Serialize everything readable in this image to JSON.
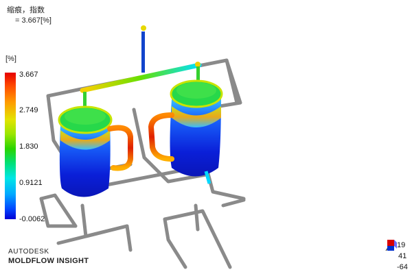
{
  "result": {
    "name": "缩痕，指数",
    "value_line": "= 3.667[%]"
  },
  "legend": {
    "unit": "[%]",
    "ticks": [
      "3.667",
      "2.749",
      "1.830",
      "0.9121",
      "-0.0062"
    ],
    "colors": [
      "#e60000",
      "#ff9a00",
      "#e3e300",
      "#29d400",
      "#00e6e6",
      "#0046ff",
      "#0000d4"
    ]
  },
  "branding": {
    "line1": "AUTODESK",
    "line2": "MOLDFLOW INSIGHT"
  },
  "triad": {
    "values": [
      "19",
      "41",
      "-64"
    ]
  }
}
